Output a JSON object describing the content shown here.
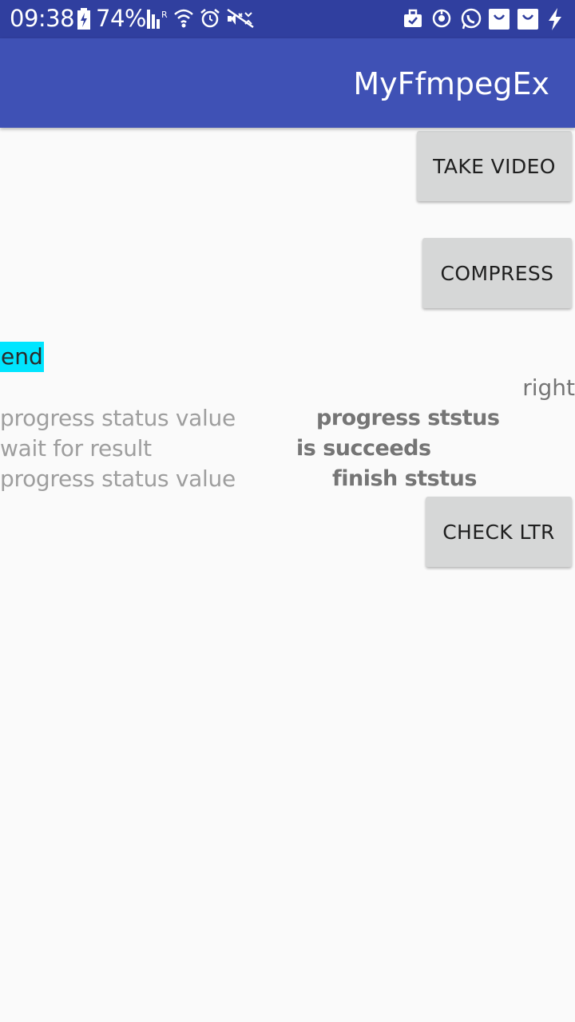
{
  "status_bar": {
    "time": "09:38",
    "battery_percent": "74%",
    "icons": [
      "battery-charging-icon",
      "signal-icon",
      "wifi-icon",
      "alarm-icon",
      "mute-icon",
      "work-briefcase-icon",
      "sync-icon",
      "whatsapp-icon",
      "notification-icon",
      "notification-icon",
      "charging-bolt-icon"
    ]
  },
  "app_bar": {
    "title": "MyFfmpegEx"
  },
  "buttons": {
    "take_video": "TAKE VIDEO",
    "compress": "COMPRESS",
    "check_ltr": "CHECK LTR"
  },
  "labels": {
    "end": "end",
    "right": "right"
  },
  "rows": [
    {
      "left": "progress status value",
      "right": "progress ststus"
    },
    {
      "left": "wait for result",
      "right": "is succeeds"
    },
    {
      "left": "progress status value",
      "right": "finish ststus"
    }
  ],
  "colors": {
    "status_bar": "#303f9f",
    "app_bar": "#3f51b5",
    "button": "#d6d7d7",
    "end_highlight": "#00e5ff",
    "background": "#fafafa"
  }
}
